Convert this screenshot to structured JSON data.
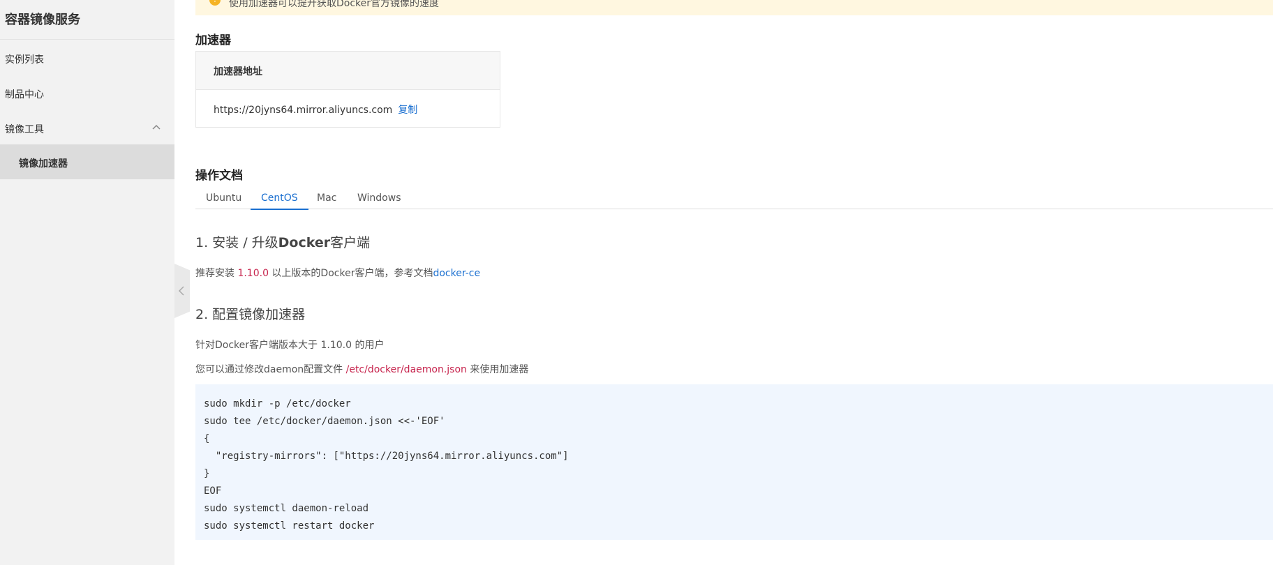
{
  "sidebar": {
    "title": "容器镜像服务",
    "items": [
      {
        "label": "实例列表"
      },
      {
        "label": "制品中心"
      },
      {
        "label": "镜像工具"
      },
      {
        "label": "镜像加速器"
      }
    ]
  },
  "notice": {
    "text": "使用加速器可以提升获取Docker官方镜像的速度"
  },
  "accelerator": {
    "section_title": "加速器",
    "header": "加速器地址",
    "url": "https://20jyns64.mirror.aliyuncs.com",
    "copy_label": "复制"
  },
  "docs": {
    "section_title": "操作文档",
    "tabs": [
      {
        "label": "Ubuntu"
      },
      {
        "label": "CentOS"
      },
      {
        "label": "Mac"
      },
      {
        "label": "Windows"
      }
    ],
    "active_tab": "CentOS",
    "step1": {
      "num": "1. 安装 / 升级",
      "bold": "Docker",
      "rest": "客户端",
      "text_pre": "推荐安装 ",
      "version": "1.10.0",
      "text_mid": " 以上版本的Docker客户端，参考文档",
      "link": "docker-ce"
    },
    "step2": {
      "title": "2. 配置镜像加速器",
      "line1": "针对Docker客户端版本大于 1.10.0 的用户",
      "line2_pre": "您可以通过修改daemon配置文件 ",
      "path": "/etc/docker/daemon.json",
      "line2_post": " 来使用加速器",
      "code": "sudo mkdir -p /etc/docker\nsudo tee /etc/docker/daemon.json <<-'EOF'\n{\n  \"registry-mirrors\": [\"https://20jyns64.mirror.aliyuncs.com\"]\n}\nEOF\nsudo systemctl daemon-reload\nsudo systemctl restart docker"
    }
  },
  "colors": {
    "accent": "#1a6fd0",
    "highlight": "#c7254e",
    "code_bg": "#f0f6fe"
  }
}
